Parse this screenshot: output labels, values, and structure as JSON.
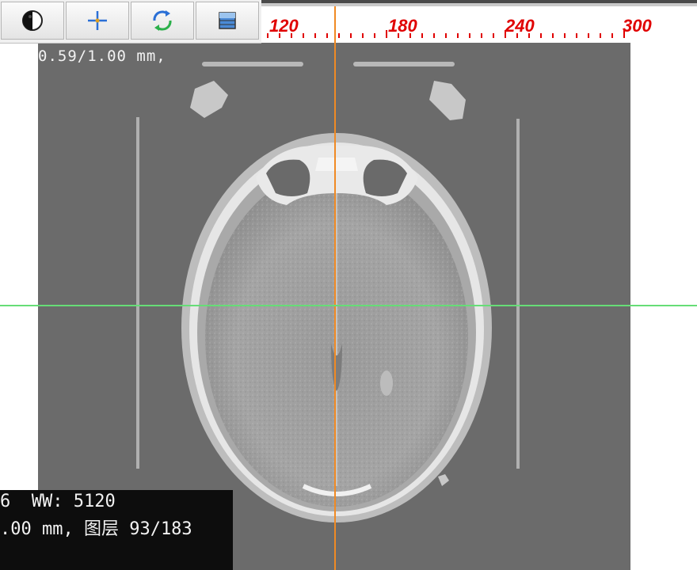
{
  "toolbar": {
    "buttons": [
      {
        "name": "window-level-button",
        "icon": "half-circle-contrast-icon"
      },
      {
        "name": "crosshair-button",
        "icon": "crosshair-icon"
      },
      {
        "name": "rotate-button",
        "icon": "rotate-arrows-icon"
      },
      {
        "name": "slab-button",
        "icon": "layers-icon"
      }
    ]
  },
  "ruler": {
    "labels": [
      "120",
      "180",
      "240",
      "300"
    ],
    "color": "#e00000"
  },
  "overlay": {
    "scale_text": "0.59/1.00 mm,",
    "window_line": "6  WW: 5120",
    "slice_line": ".00 mm, 图层 93/183"
  },
  "crosshair": {
    "vertical_color": "#f08a24",
    "horizontal_color": "#66dd77"
  },
  "image": {
    "modality": "CT axial head slice",
    "background_color": "#6b6b6b"
  }
}
